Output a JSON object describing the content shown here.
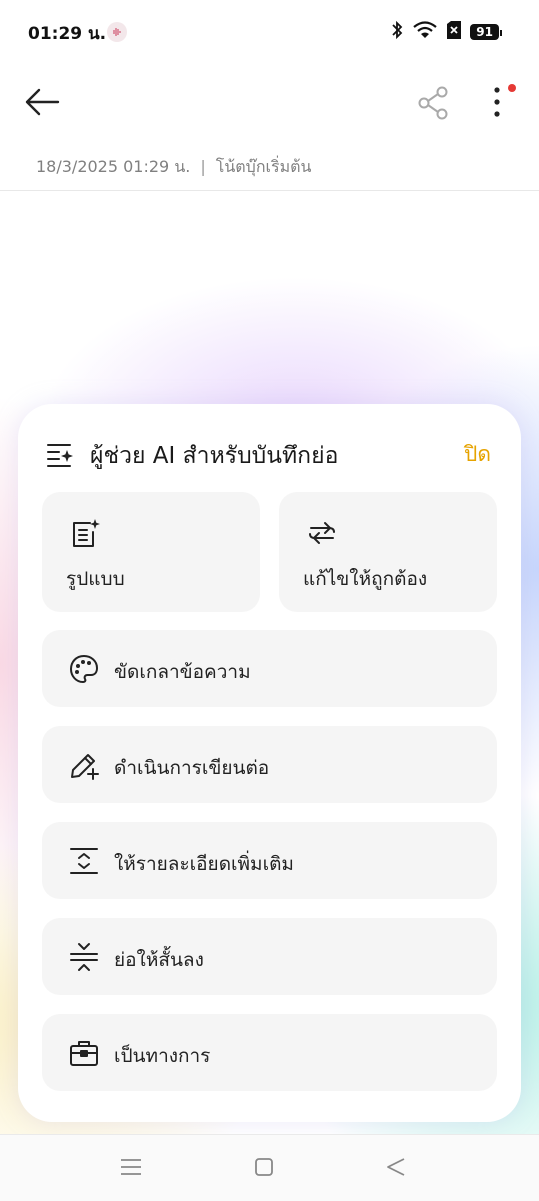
{
  "status_bar": {
    "time": "01:29 น.",
    "battery": "91"
  },
  "note": {
    "date": "18/3/2025 01:29 น.",
    "separator": "|",
    "notebook": "โน้ตบุ๊กเริ่มต้น"
  },
  "ai_panel": {
    "title": "ผู้ช่วย AI สำหรับบันทึกย่อ",
    "close_label": "ปิด",
    "actions": [
      {
        "label": "รูปแบบ",
        "icon": "format-document-icon"
      },
      {
        "label": "แก้ไขให้ถูกต้อง",
        "icon": "swap-arrows-icon"
      },
      {
        "label": "ขัดเกลาข้อความ",
        "icon": "palette-icon"
      },
      {
        "label": "ดำเนินการเขียนต่อ",
        "icon": "pencil-plus-icon"
      },
      {
        "label": "ให้รายละเอียดเพิ่มเติม",
        "icon": "expand-icon"
      },
      {
        "label": "ย่อให้สั้นลง",
        "icon": "collapse-icon"
      },
      {
        "label": "เป็นทางการ",
        "icon": "briefcase-icon"
      }
    ]
  },
  "colors": {
    "accent": "#e6a300",
    "notification_dot": "#e53935",
    "card_bg": "#f5f5f5"
  }
}
